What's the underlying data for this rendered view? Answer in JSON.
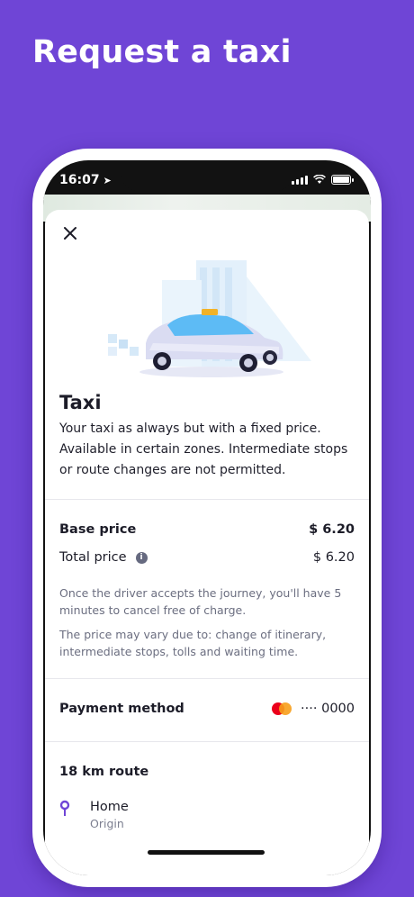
{
  "headline": "Request a taxi",
  "status_bar": {
    "time": "16:07"
  },
  "service": {
    "title": "Taxi",
    "description": "Your taxi as always but with a fixed price. Available in certain zones. Intermediate stops or route changes are not permitted."
  },
  "pricing": {
    "base_label": "Base price",
    "base_value": "$ 6.20",
    "total_label": "Total price",
    "total_value": "$ 6.20",
    "note_cancel": "Once the driver accepts the journey, you'll have 5 minutes to cancel free of charge.",
    "note_vary": "The price may vary due to: change of itinerary, intermediate stops, tolls and waiting time."
  },
  "payment": {
    "label": "Payment method",
    "card_masked": "···· 0000",
    "card_icon": "mastercard-icon"
  },
  "route": {
    "title": "18 km route",
    "origin_name": "Home",
    "origin_label": "Origin"
  },
  "colors": {
    "background": "#6f45d6",
    "accent": "#6f45d6"
  }
}
